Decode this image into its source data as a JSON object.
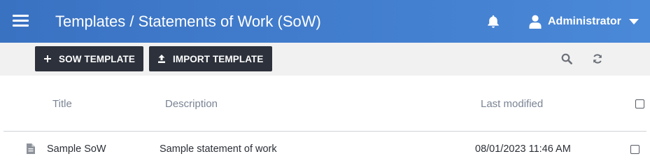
{
  "header": {
    "title": "Templates / Statements of Work (SoW)",
    "user_name": "Administrator",
    "menu_icon": "hamburger-menu-icon",
    "notification_icon": "bell-icon",
    "user_icon": "user-icon",
    "dropdown_icon": "caret-down-icon"
  },
  "toolbar": {
    "sow_template_label": "SOW TEMPLATE",
    "import_template_label": "IMPORT TEMPLATE",
    "search_icon": "search-icon",
    "refresh_icon": "refresh-icon"
  },
  "table": {
    "columns": [
      "Title",
      "Description",
      "Last modified"
    ],
    "rows": [
      {
        "title": "Sample SoW",
        "description": "Sample statement of work",
        "last_modified": "08/01/2023 11:46 AM",
        "icon": "document-icon",
        "checked": false
      }
    ]
  },
  "colors": {
    "header_start": "#3a72c2",
    "header_end": "#4a88d8",
    "toolbar_bg": "#f1f1f1",
    "button_bg": "#2c313b",
    "column_header_text": "#7a8494"
  }
}
